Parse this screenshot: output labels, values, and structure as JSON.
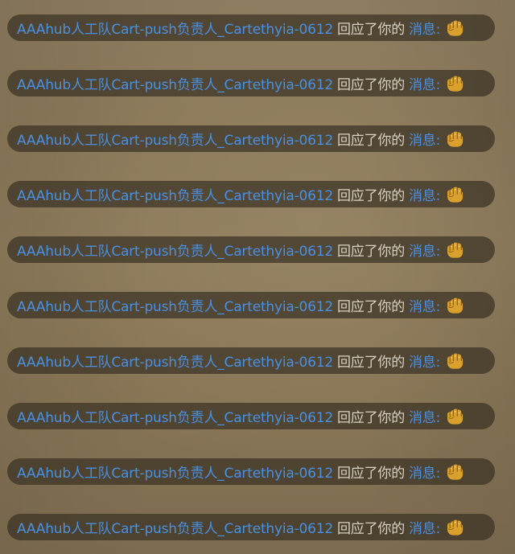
{
  "notifications": [
    {
      "user": "AAAhub人工队Cart-push负责人_Cartethyia-0612",
      "action": "回应了你的",
      "link": "消息:",
      "icon": "punch-icon"
    },
    {
      "user": "AAAhub人工队Cart-push负责人_Cartethyia-0612",
      "action": "回应了你的",
      "link": "消息:",
      "icon": "punch-icon"
    },
    {
      "user": "AAAhub人工队Cart-push负责人_Cartethyia-0612",
      "action": "回应了你的",
      "link": "消息:",
      "icon": "punch-icon"
    },
    {
      "user": "AAAhub人工队Cart-push负责人_Cartethyia-0612",
      "action": "回应了你的",
      "link": "消息:",
      "icon": "punch-icon"
    },
    {
      "user": "AAAhub人工队Cart-push负责人_Cartethyia-0612",
      "action": "回应了你的",
      "link": "消息:",
      "icon": "punch-icon"
    },
    {
      "user": "AAAhub人工队Cart-push负责人_Cartethyia-0612",
      "action": "回应了你的",
      "link": "消息:",
      "icon": "punch-icon"
    },
    {
      "user": "AAAhub人工队Cart-push负责人_Cartethyia-0612",
      "action": "回应了你的",
      "link": "消息:",
      "icon": "punch-icon"
    },
    {
      "user": "AAAhub人工队Cart-push负责人_Cartethyia-0612",
      "action": "回应了你的",
      "link": "消息:",
      "icon": "punch-icon"
    },
    {
      "user": "AAAhub人工队Cart-push负责人_Cartethyia-0612",
      "action": "回应了你的",
      "link": "消息:",
      "icon": "punch-icon"
    },
    {
      "user": "AAAhub人工队Cart-push负责人_Cartethyia-0612",
      "action": "回应了你的",
      "link": "消息:",
      "icon": "punch-icon"
    }
  ],
  "colors": {
    "username": "#4a90e2",
    "action_text": "#d9d1c3",
    "pill_background": "#3a3224"
  }
}
